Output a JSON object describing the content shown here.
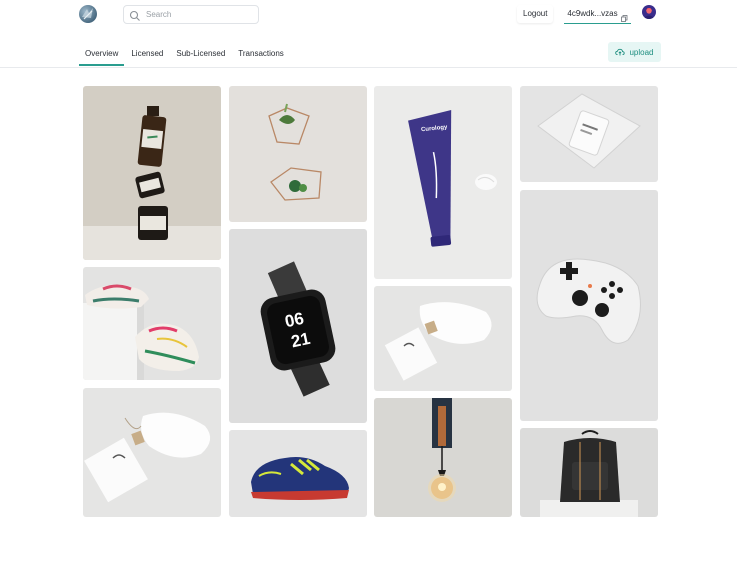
{
  "header": {
    "search_placeholder": "Search",
    "logout_label": "Logout",
    "wallet_label": "4c9wdk...vzas"
  },
  "tabs": [
    {
      "label": "Overview",
      "active": true
    },
    {
      "label": "Licensed",
      "active": false
    },
    {
      "label": "Sub-Licensed",
      "active": false
    },
    {
      "label": "Transactions",
      "active": false
    }
  ],
  "actions": {
    "upload_label": "upload"
  },
  "colors": {
    "accent": "#2a9d8f",
    "upload_bg": "#e6f6f4",
    "upload_text": "#1f8f80"
  },
  "gallery": {
    "items": [
      {
        "name": "cannabis-oil-bottle-jars"
      },
      {
        "name": "sneakers-pink-green"
      },
      {
        "name": "white-pouch-and-card"
      },
      {
        "name": "geometric-planters"
      },
      {
        "name": "smartwatch-0621"
      },
      {
        "name": "blue-soccer-shoe"
      },
      {
        "name": "curology-tube",
        "brand_text": "Curology"
      },
      {
        "name": "white-pouch-and-card"
      },
      {
        "name": "hanging-bulb-lamp"
      },
      {
        "name": "glass-box-product"
      },
      {
        "name": "white-game-controller"
      },
      {
        "name": "black-leather-backpack"
      }
    ]
  },
  "watch": {
    "top": "06",
    "bottom": "21"
  }
}
